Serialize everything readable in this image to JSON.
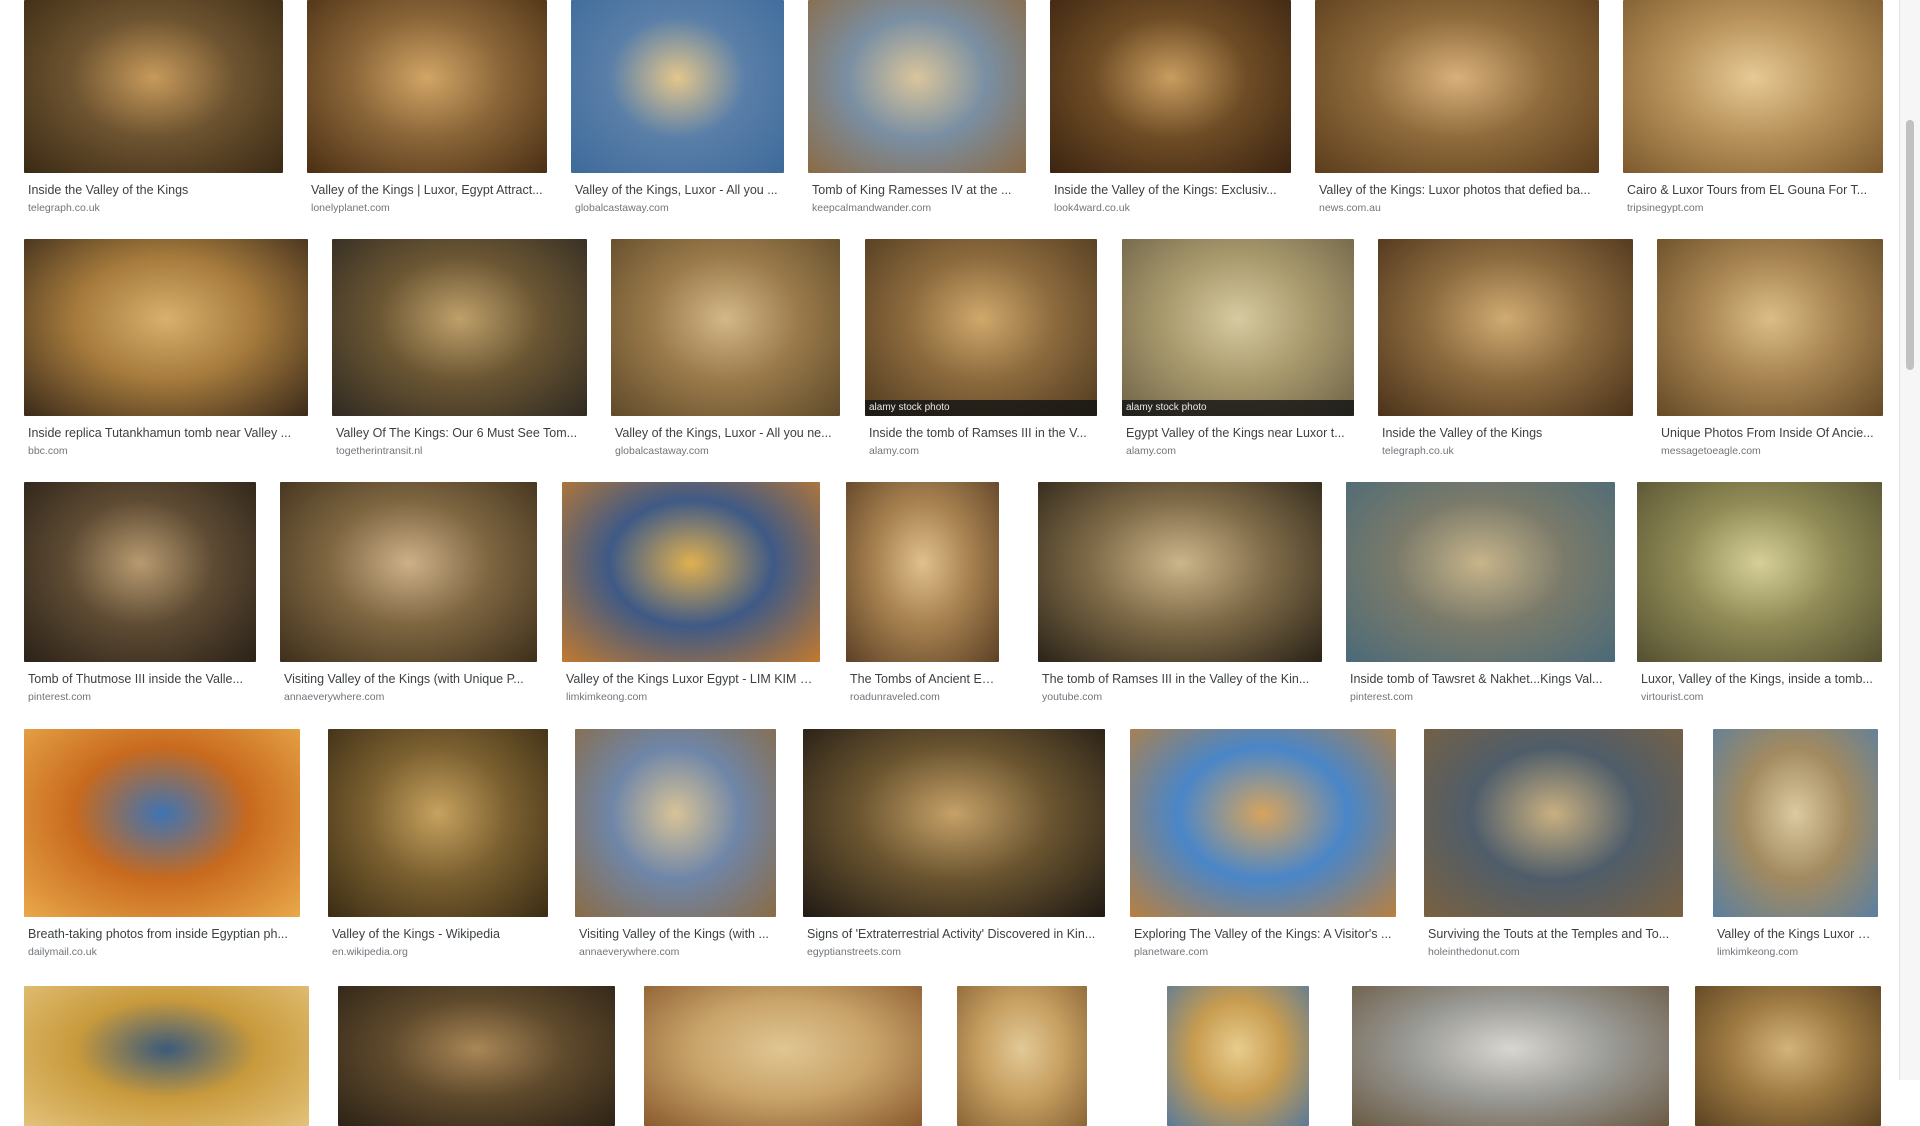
{
  "rows": [
    [
      {
        "title": "Inside the Valley of the Kings",
        "site": "telegraph.co.uk",
        "colors": [
          "#6d5330",
          "#c79a5b",
          "#3a2a14"
        ]
      },
      {
        "title": "Valley of the Kings | Luxor, Egypt Attract...",
        "site": "lonelyplanet.com",
        "colors": [
          "#8a6538",
          "#d2a566",
          "#4a2f14"
        ]
      },
      {
        "title": "Valley of the Kings, Luxor - All you ...",
        "site": "globalcastaway.com",
        "colors": [
          "#5a7fa8",
          "#e3c68c",
          "#3d6a9b"
        ]
      },
      {
        "title": "Tomb of King Ramesses IV at the ...",
        "site": "keepcalmandwander.com",
        "colors": [
          "#7a8fa3",
          "#d9c59b",
          "#8b6a44"
        ]
      },
      {
        "title": "Inside the Valley of the Kings: Exclusiv...",
        "site": "look4ward.co.uk",
        "colors": [
          "#6e4c25",
          "#c99d60",
          "#3b2411"
        ]
      },
      {
        "title": "Valley of the Kings: Luxor photos that defied ba...",
        "site": "news.com.au",
        "colors": [
          "#8f6b3c",
          "#d8b07a",
          "#5b3d1c"
        ]
      },
      {
        "title": "Cairo & Luxor Tours from EL Gouna For T...",
        "site": "tripsinegypt.com",
        "colors": [
          "#b8925a",
          "#e6c995",
          "#7c5a2e"
        ]
      }
    ],
    [
      {
        "title": "Inside replica Tutankhamun tomb near Valley ...",
        "site": "bbc.com",
        "colors": [
          "#a57a3c",
          "#d9b06d",
          "#3a2a1a"
        ],
        "stock": ""
      },
      {
        "title": "Valley Of The Kings: Our 6 Must See Tom...",
        "site": "togetherintransit.nl",
        "colors": [
          "#6b5633",
          "#bfa06a",
          "#2f2a22"
        ],
        "stock": ""
      },
      {
        "title": "Valley of the Kings, Luxor - All you ne...",
        "site": "globalcastaway.com",
        "colors": [
          "#9a7a4a",
          "#d4b887",
          "#5f4a2a"
        ],
        "stock": ""
      },
      {
        "title": "Inside the tomb of Ramses III in the V...",
        "site": "alamy.com",
        "colors": [
          "#8c6a3d",
          "#cfa86b",
          "#4f3a20"
        ],
        "stock": "alamy stock photo"
      },
      {
        "title": "Egypt Valley of the Kings near Luxor t...",
        "site": "alamy.com",
        "colors": [
          "#a99a6d",
          "#d7caa0",
          "#6e6248"
        ],
        "stock": "alamy stock photo"
      },
      {
        "title": "Inside the Valley of the Kings",
        "site": "telegraph.co.uk",
        "colors": [
          "#8b6a3e",
          "#d0ab72",
          "#4a321a"
        ],
        "stock": ""
      },
      {
        "title": "Unique Photos From Inside Of Ancie...",
        "site": "messagetoeagle.com",
        "colors": [
          "#a68350",
          "#dbbd87",
          "#654a27"
        ],
        "stock": ""
      }
    ],
    [
      {
        "title": "Tomb of Thutmose III inside the Valle...",
        "site": "pinterest.com",
        "colors": [
          "#5e4b33",
          "#b89a70",
          "#2a2118"
        ]
      },
      {
        "title": "Visiting Valley of the Kings (with Unique P...",
        "site": "annaeverywhere.com",
        "colors": [
          "#7d6540",
          "#cdb088",
          "#3e2f1c"
        ]
      },
      {
        "title": "Valley of the Kings Luxor Egypt - LIM KIM K...",
        "site": "limkimkeong.com",
        "colors": [
          "#3f5a86",
          "#e0b050",
          "#c27a2e"
        ]
      },
      {
        "title": "The Tombs of Ancient Egy...",
        "site": "roadunraveled.com",
        "colors": [
          "#a6804f",
          "#e0c08d",
          "#5c4126"
        ]
      },
      {
        "title": "The tomb of Ramses III in the Valley of the Kin...",
        "site": "youtube.com",
        "colors": [
          "#7e6a47",
          "#cbb58a",
          "#2a2318"
        ]
      },
      {
        "title": "Inside tomb of Tawsret & Nakhet...Kings Val...",
        "site": "pinterest.com",
        "colors": [
          "#7a7a6a",
          "#c7b48a",
          "#4a6a78"
        ]
      },
      {
        "title": "Luxor, Valley of the Kings, inside a tomb...",
        "site": "virtourist.com",
        "colors": [
          "#8f8a55",
          "#d6cf98",
          "#545031"
        ]
      }
    ],
    [
      {
        "title": "Breath-taking photos from inside Egyptian ph...",
        "site": "dailymail.co.uk",
        "colors": [
          "#c86a1e",
          "#3f74b3",
          "#e9a94a"
        ]
      },
      {
        "title": "Valley of the Kings - Wikipedia",
        "site": "en.wikipedia.org",
        "colors": [
          "#7b6030",
          "#c7a25f",
          "#3a2c14"
        ]
      },
      {
        "title": "Visiting Valley of the Kings (with ...",
        "site": "annaeverywhere.com",
        "colors": [
          "#6f86a8",
          "#d8c397",
          "#8a6b45"
        ]
      },
      {
        "title": "Signs of 'Extraterrestrial Activity' Discovered in Kin...",
        "site": "egyptianstreets.com",
        "colors": [
          "#6b5530",
          "#c6a168",
          "#1f1a14"
        ]
      },
      {
        "title": "Exploring The Valley of the Kings: A Visitor's ...",
        "site": "planetware.com",
        "colors": [
          "#4a86c8",
          "#d6a45e",
          "#b8803f"
        ]
      },
      {
        "title": "Surviving the Touts at the Temples and To...",
        "site": "holeinthedonut.com",
        "colors": [
          "#4f5d6a",
          "#c9b080",
          "#7a6140"
        ]
      },
      {
        "title": "Valley of the Kings Luxor E...",
        "site": "limkimkeong.com",
        "colors": [
          "#a28a60",
          "#ddcaa0",
          "#5b7fa0"
        ]
      }
    ],
    [
      {
        "colors": [
          "#c89a3c",
          "#3c5a7a",
          "#e3c27a"
        ]
      },
      {
        "colors": [
          "#5f4a2c",
          "#a98656",
          "#2c2216"
        ]
      },
      {
        "colors": [
          "#c9a46a",
          "#e0c693",
          "#8a5a2e"
        ]
      },
      {
        "colors": [
          "#c7a062",
          "#e2c996",
          "#8a6536"
        ]
      },
      {
        "colors": [
          "#c79c50",
          "#e8cc8c",
          "#5a7a9a"
        ]
      },
      {
        "colors": [
          "#9a9a96",
          "#d8d6d0",
          "#6a5a44"
        ]
      },
      {
        "colors": [
          "#9e7a42",
          "#d3b37a",
          "#5a4222"
        ]
      }
    ]
  ]
}
